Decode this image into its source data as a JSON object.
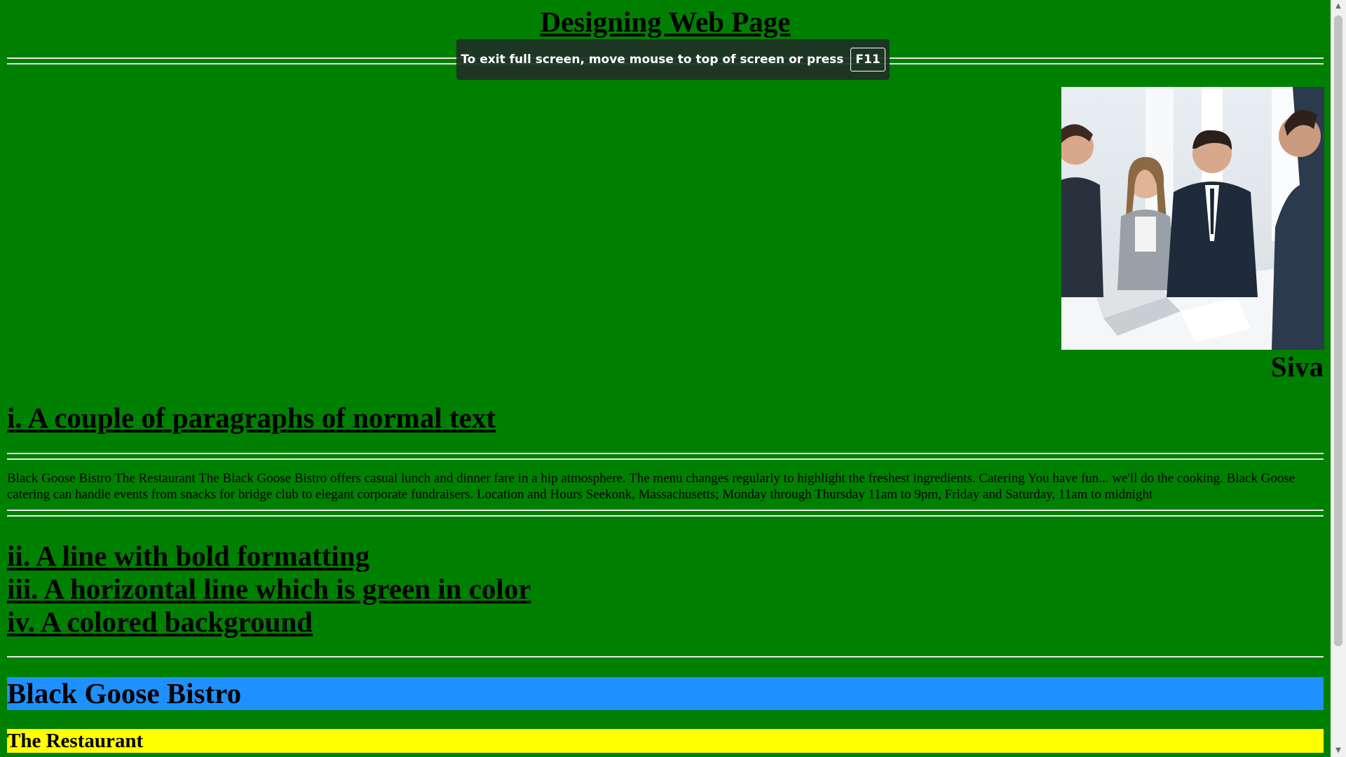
{
  "page": {
    "title": "Designing Web Page",
    "photo_caption": "Siva",
    "headings": [
      "i. A couple of paragraphs of normal text",
      "ii. A line with bold formatting",
      "iii. A horizontal line which is green in color",
      "iv. A colored background"
    ],
    "paragraph": "Black Goose Bistro The Restaurant The Black Goose Bistro offers casual lunch and dinner fare in a hip atmosphere. The menu changes regularly to highlight the freshest ingredients. Catering You have fun... we'll do the cooking. Black Goose catering can handle events from snacks for bridge club to elegant corporate fundraisers. Location and Hours Seekonk, Massachusetts; Monday through Thursday 11am to 9pm, Friday and Saturday, 11am to midnight",
    "blue_bar": "Black Goose Bistro",
    "yellow_bar": "The Restaurant"
  },
  "fullscreen_toast": {
    "message": "To exit full screen, move mouse to top of screen or press",
    "key": "F11"
  },
  "colors": {
    "background": "#008000",
    "blue_bar": "#1e90ff",
    "yellow_bar": "#ffff00"
  }
}
